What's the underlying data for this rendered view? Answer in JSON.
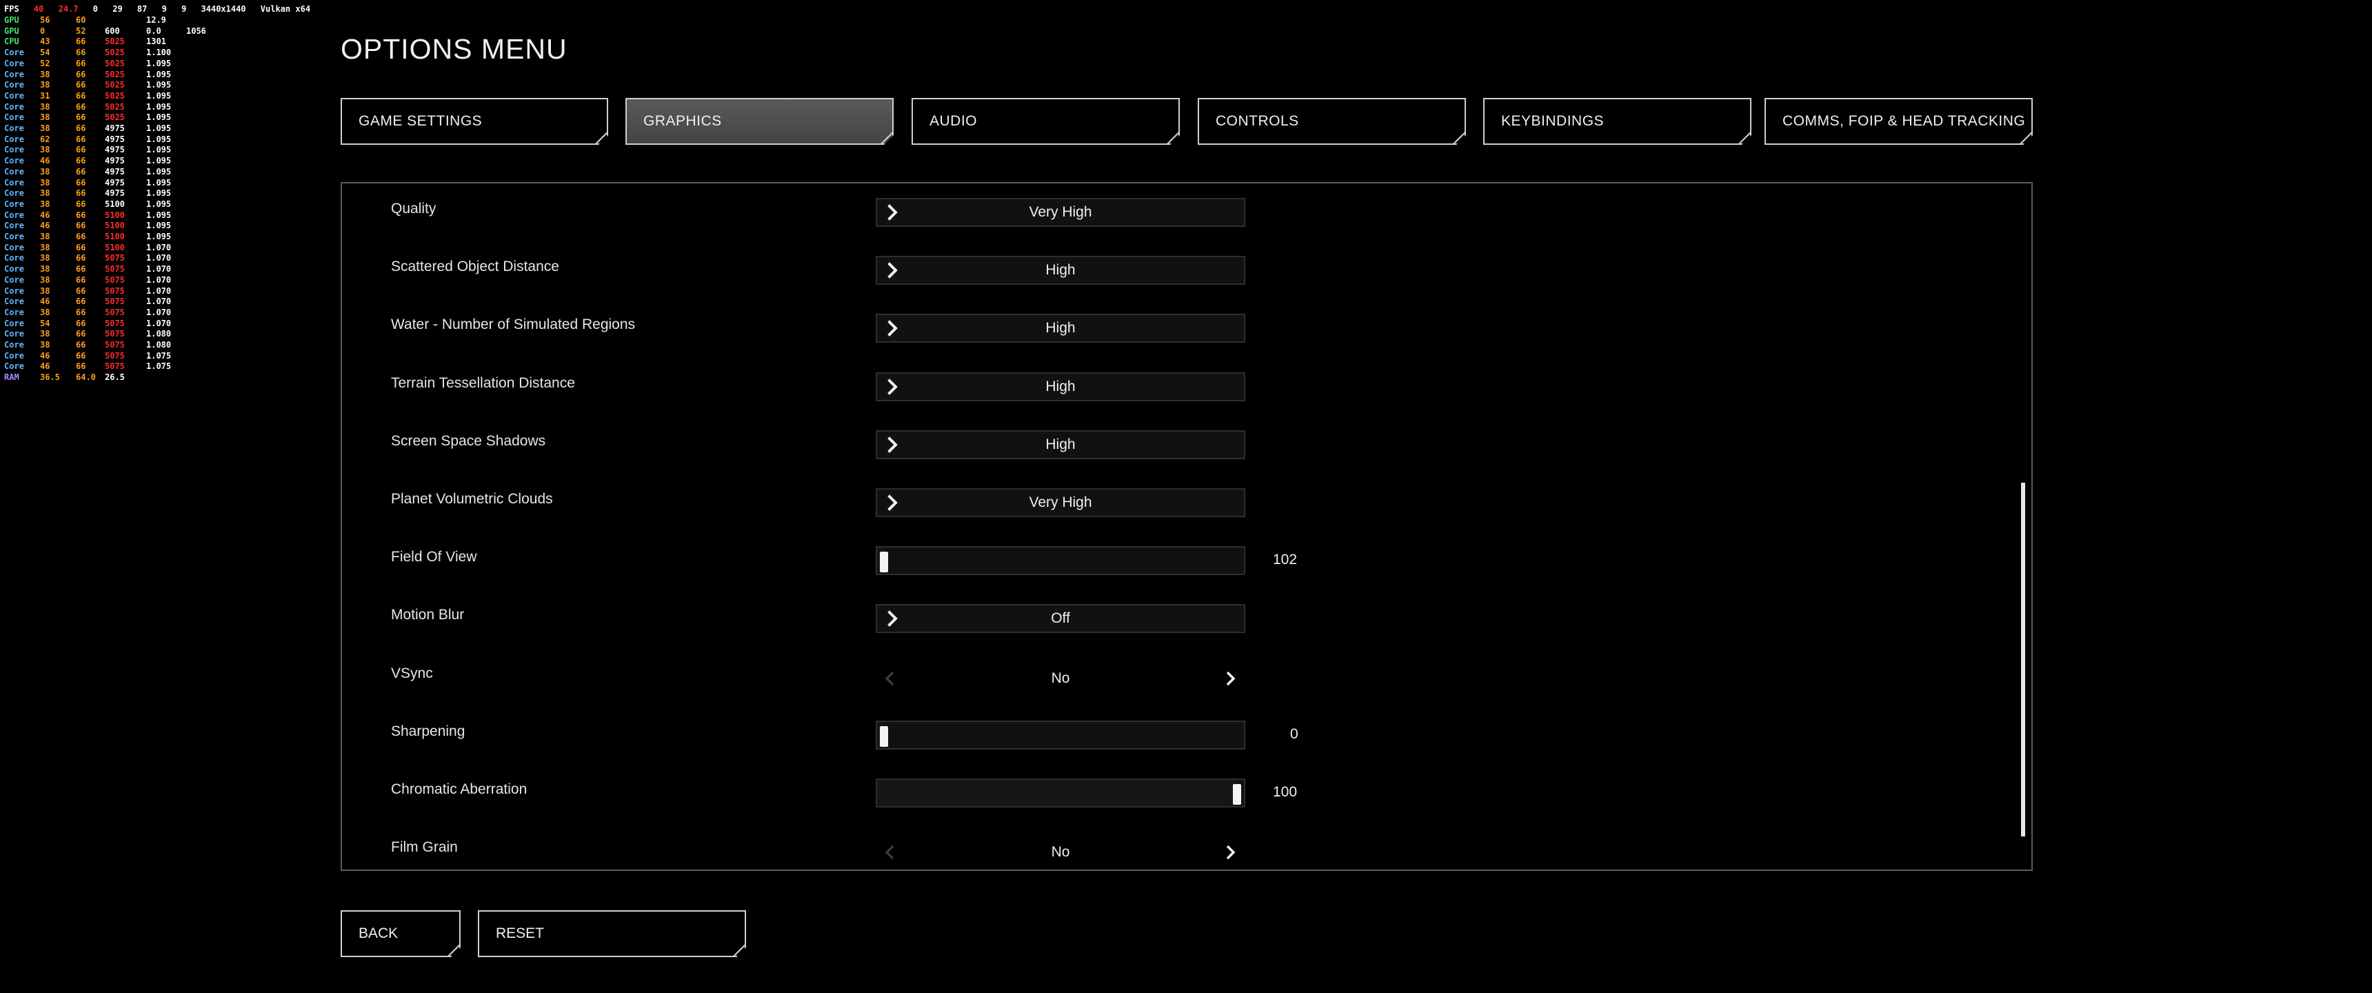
{
  "overlay": {
    "header": [
      "FPS",
      "40",
      "24.7",
      "0",
      "29",
      "87",
      "9",
      "9",
      "3440x1440",
      "Vulkan x64"
    ],
    "rows": [
      {
        "label": "GPU",
        "a": "56",
        "b": "60",
        "c": "",
        "d": "12.9",
        "e": ""
      },
      {
        "label": "GPU",
        "a": "0",
        "b": "52",
        "c": "600",
        "d": "0.0",
        "e": "1056"
      },
      {
        "label": "CPU",
        "a": "43",
        "b": "66",
        "c": "5025",
        "d": "1301",
        "e": ""
      },
      {
        "label": "Core",
        "a": "54",
        "b": "66",
        "c": "5025",
        "d": "1.100",
        "e": ""
      },
      {
        "label": "Core",
        "a": "52",
        "b": "66",
        "c": "5025",
        "d": "1.095",
        "e": ""
      },
      {
        "label": "Core",
        "a": "38",
        "b": "66",
        "c": "5025",
        "d": "1.095",
        "e": ""
      },
      {
        "label": "Core",
        "a": "38",
        "b": "66",
        "c": "5025",
        "d": "1.095",
        "e": ""
      },
      {
        "label": "Core",
        "a": "31",
        "b": "66",
        "c": "5025",
        "d": "1.095",
        "e": ""
      },
      {
        "label": "Core",
        "a": "38",
        "b": "66",
        "c": "5025",
        "d": "1.095",
        "e": ""
      },
      {
        "label": "Core",
        "a": "38",
        "b": "66",
        "c": "5025",
        "d": "1.095",
        "e": ""
      },
      {
        "label": "Core",
        "a": "38",
        "b": "66",
        "c": "4975",
        "d": "1.095",
        "e": ""
      },
      {
        "label": "Core",
        "a": "62",
        "b": "66",
        "c": "4975",
        "d": "1.095",
        "e": ""
      },
      {
        "label": "Core",
        "a": "38",
        "b": "66",
        "c": "4975",
        "d": "1.095",
        "e": ""
      },
      {
        "label": "Core",
        "a": "46",
        "b": "66",
        "c": "4975",
        "d": "1.095",
        "e": ""
      },
      {
        "label": "Core",
        "a": "38",
        "b": "66",
        "c": "4975",
        "d": "1.095",
        "e": ""
      },
      {
        "label": "Core",
        "a": "38",
        "b": "66",
        "c": "4975",
        "d": "1.095",
        "e": ""
      },
      {
        "label": "Core",
        "a": "38",
        "b": "66",
        "c": "4975",
        "d": "1.095",
        "e": ""
      },
      {
        "label": "Core",
        "a": "38",
        "b": "66",
        "c": "5100",
        "d": "1.095",
        "e": ""
      },
      {
        "label": "Core",
        "a": "46",
        "b": "66",
        "c": "5100",
        "d": "1.095",
        "e": ""
      },
      {
        "label": "Core",
        "a": "46",
        "b": "66",
        "c": "5100",
        "d": "1.095",
        "e": ""
      },
      {
        "label": "Core",
        "a": "38",
        "b": "66",
        "c": "5100",
        "d": "1.095",
        "e": ""
      },
      {
        "label": "Core",
        "a": "38",
        "b": "66",
        "c": "5100",
        "d": "1.070",
        "e": ""
      },
      {
        "label": "Core",
        "a": "38",
        "b": "66",
        "c": "5075",
        "d": "1.070",
        "e": ""
      },
      {
        "label": "Core",
        "a": "38",
        "b": "66",
        "c": "5075",
        "d": "1.070",
        "e": ""
      },
      {
        "label": "Core",
        "a": "38",
        "b": "66",
        "c": "5075",
        "d": "1.070",
        "e": ""
      },
      {
        "label": "Core",
        "a": "38",
        "b": "66",
        "c": "5075",
        "d": "1.070",
        "e": ""
      },
      {
        "label": "Core",
        "a": "46",
        "b": "66",
        "c": "5075",
        "d": "1.070",
        "e": ""
      },
      {
        "label": "Core",
        "a": "38",
        "b": "66",
        "c": "5075",
        "d": "1.070",
        "e": ""
      },
      {
        "label": "Core",
        "a": "54",
        "b": "66",
        "c": "5075",
        "d": "1.070",
        "e": ""
      },
      {
        "label": "Core",
        "a": "38",
        "b": "66",
        "c": "5075",
        "d": "1.080",
        "e": ""
      },
      {
        "label": "Core",
        "a": "38",
        "b": "66",
        "c": "5075",
        "d": "1.080",
        "e": ""
      },
      {
        "label": "Core",
        "a": "46",
        "b": "66",
        "c": "5075",
        "d": "1.075",
        "e": ""
      },
      {
        "label": "Core",
        "a": "46",
        "b": "66",
        "c": "5075",
        "d": "1.075",
        "e": ""
      },
      {
        "label": "RAM",
        "a": "36.5",
        "b": "64.0",
        "c": "26.5",
        "d": "",
        "e": ""
      }
    ]
  },
  "title": "OPTIONS MENU",
  "tabs": [
    {
      "label": "GAME SETTINGS",
      "active": false
    },
    {
      "label": "GRAPHICS",
      "active": true
    },
    {
      "label": "AUDIO",
      "active": false
    },
    {
      "label": "CONTROLS",
      "active": false
    },
    {
      "label": "KEYBINDINGS",
      "active": false
    },
    {
      "label": "COMMS, FOIP & HEAD TRACKING",
      "active": false
    }
  ],
  "settings": [
    {
      "label": "Quality",
      "type": "select",
      "value": "Very High"
    },
    {
      "label": "Scattered Object Distance",
      "type": "select",
      "value": "High"
    },
    {
      "label": "Water - Number of Simulated Regions",
      "type": "select",
      "value": "High"
    },
    {
      "label": "Terrain Tessellation Distance",
      "type": "select",
      "value": "High"
    },
    {
      "label": "Screen Space Shadows",
      "type": "select",
      "value": "High"
    },
    {
      "label": "Planet Volumetric Clouds",
      "type": "select",
      "value": "Very High"
    },
    {
      "label": "Field Of View",
      "type": "slider",
      "value": "102",
      "fraction": 0.0
    },
    {
      "label": "Motion Blur",
      "type": "select",
      "value": "Off"
    },
    {
      "label": "VSync",
      "type": "toggle",
      "value": "No"
    },
    {
      "label": "Sharpening",
      "type": "slider",
      "value": "0",
      "fraction": 0.0
    },
    {
      "label": "Chromatic Aberration",
      "type": "slider",
      "value": "100",
      "fraction": 1.0
    },
    {
      "label": "Film Grain",
      "type": "toggle",
      "value": "No"
    }
  ],
  "buttons": {
    "back": "BACK",
    "reset": "RESET"
  }
}
